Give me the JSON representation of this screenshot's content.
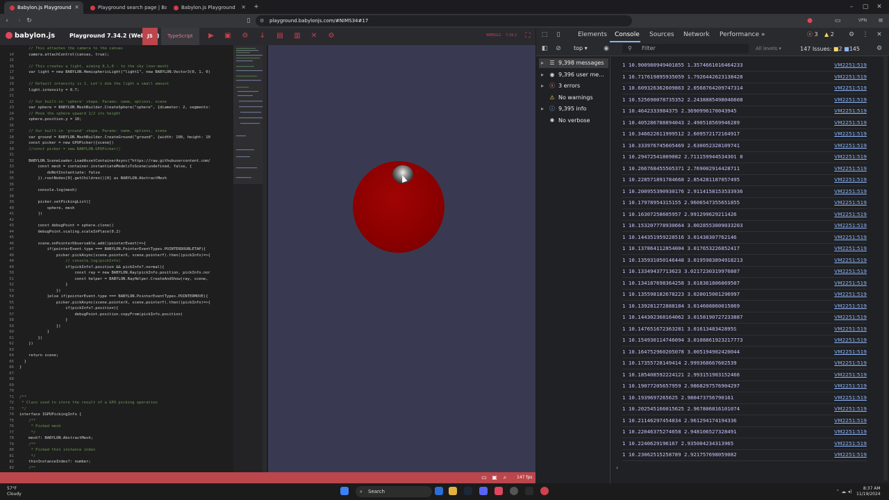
{
  "browser": {
    "tabs": [
      {
        "label": "Babylon.js Playground"
      },
      {
        "label": "Playground search page | Babylon.js"
      },
      {
        "label": "Babylon.js Playground"
      }
    ],
    "url": "playground.babylonjs.com/#NIMS34#17",
    "vpn": "VPN"
  },
  "playground": {
    "logo": "babylon.js",
    "title": "Playground 7.34.2 (WebGL2)",
    "js_label": "JS",
    "ts_label": "TypeScript",
    "version_a": "WEBGL2",
    "version_b": "7.34.2",
    "fps": "147 fps"
  },
  "editor": {
    "lines": [
      {
        "n": "",
        "t": "    // This attaches the camera to the canvas",
        "c": "cm"
      },
      {
        "n": "14",
        "t": "    camera.attachControl(canvas, true);",
        "c": ""
      },
      {
        "n": "15",
        "t": "",
        "c": ""
      },
      {
        "n": "16",
        "t": "    // This creates a light, aiming 0,1,0 - to the sky (non-mesh)",
        "c": "cm"
      },
      {
        "n": "17",
        "t": "    var light = new BABYLON.HemisphericLight(\"light1\", new BABYLON.Vector3(0, 1, 0)",
        "c": ""
      },
      {
        "n": "18",
        "t": "",
        "c": ""
      },
      {
        "n": "19",
        "t": "    // Default intensity is 1. Let's dim the light a small amount",
        "c": "cm"
      },
      {
        "n": "20",
        "t": "    light.intensity = 0.7;",
        "c": ""
      },
      {
        "n": "21",
        "t": "",
        "c": ""
      },
      {
        "n": "22",
        "t": "    // Our built-in 'sphere' shape. Params: name, options, scene",
        "c": "cm"
      },
      {
        "n": "23",
        "t": "    var sphere = BABYLON.MeshBuilder.CreateSphere(\"sphere\", {diameter: 2, segments:",
        "c": ""
      },
      {
        "n": "24",
        "t": "    // Move the sphere upward 1/2 its height",
        "c": "cm"
      },
      {
        "n": "25",
        "t": "    sphere.position.y = 10;",
        "c": ""
      },
      {
        "n": "26",
        "t": "",
        "c": ""
      },
      {
        "n": "27",
        "t": "    // Our built-in 'ground' shape. Params: name, options, scene",
        "c": "cm"
      },
      {
        "n": "28",
        "t": "    var ground = BABYLON.MeshBuilder.CreateGround(\"ground\", {width: 100, height: 10",
        "c": ""
      },
      {
        "n": "29",
        "t": "    const picker = new GPUPicker({scene})",
        "c": ""
      },
      {
        "n": "30",
        "t": "    //const picker = new BABYLON.GPUPicker()",
        "c": "cm"
      },
      {
        "n": "31",
        "t": "",
        "c": ""
      },
      {
        "n": "32",
        "t": "    BABYLON.SceneLoader.LoadAssetContainerAsync(\"https://raw.githubusercontent.com/",
        "c": ""
      },
      {
        "n": "33",
        "t": "        const mesh = container.instantiateModelsToScene(undefined, false, {",
        "c": ""
      },
      {
        "n": "34",
        "t": "            doNotInstantiate: false",
        "c": ""
      },
      {
        "n": "35",
        "t": "        }).rootNodes[0].getChildren()[0] as BABYLON.AbstractMesh",
        "c": ""
      },
      {
        "n": "36",
        "t": "",
        "c": ""
      },
      {
        "n": "37",
        "t": "        console.log(mesh)",
        "c": ""
      },
      {
        "n": "38",
        "t": "",
        "c": ""
      },
      {
        "n": "39",
        "t": "        picker.setPickingList([",
        "c": ""
      },
      {
        "n": "40",
        "t": "            sphere, mesh",
        "c": ""
      },
      {
        "n": "41",
        "t": "        ])",
        "c": ""
      },
      {
        "n": "42",
        "t": "",
        "c": ""
      },
      {
        "n": "43",
        "t": "        const debugPoint = sphere.clone()",
        "c": ""
      },
      {
        "n": "44",
        "t": "        debugPoint.scaling.scaleInPlace(0.2)",
        "c": ""
      },
      {
        "n": "45",
        "t": "",
        "c": ""
      },
      {
        "n": "46",
        "t": "        scene.onPointerObservable.add((pointerEvent)=>{",
        "c": ""
      },
      {
        "n": "47",
        "t": "            if(pointerEvent.type === BABYLON.PointerEventTypes.POINTERDOUBLETAP){",
        "c": ""
      },
      {
        "n": "48",
        "t": "                picker.pickAsync(scene.pointerX, scene.pointerY).then((pickInfo)=>{",
        "c": ""
      },
      {
        "n": "49",
        "t": "                    // console.log(pickInfo)",
        "c": "cm"
      },
      {
        "n": "49",
        "t": "                    if(pickInfo?.position && pickInfo?.normal){",
        "c": ""
      },
      {
        "n": "50",
        "t": "                        const ray = new BABYLON.Ray(pickInfo.position, pickInfo.nor",
        "c": ""
      },
      {
        "n": "51",
        "t": "                        const helper = BABYLON.RayHelper.CreateAndShow(ray, scene,",
        "c": ""
      },
      {
        "n": "52",
        "t": "                    }",
        "c": ""
      },
      {
        "n": "53",
        "t": "                })",
        "c": ""
      },
      {
        "n": "54",
        "t": "            }else if(pointerEvent.type === BABYLON.PointerEventTypes.POINTERMOVE){",
        "c": ""
      },
      {
        "n": "55",
        "t": "                picker.pickAsync(scene.pointerX, scene.pointerY).then((pickInfo)=>{",
        "c": ""
      },
      {
        "n": "56",
        "t": "                    if(pickInfo?.position){",
        "c": ""
      },
      {
        "n": "57",
        "t": "                        debugPoint.position.copyFrom(pickInfo.position)",
        "c": ""
      },
      {
        "n": "58",
        "t": "                    }",
        "c": ""
      },
      {
        "n": "59",
        "t": "                })",
        "c": ""
      },
      {
        "n": "60",
        "t": "            }",
        "c": ""
      },
      {
        "n": "61",
        "t": "        })",
        "c": ""
      },
      {
        "n": "62",
        "t": "    })",
        "c": ""
      },
      {
        "n": "63",
        "t": "",
        "c": ""
      },
      {
        "n": "64",
        "t": "    return scene;",
        "c": ""
      },
      {
        "n": "65",
        "t": "  }",
        "c": ""
      },
      {
        "n": "66",
        "t": "}",
        "c": ""
      },
      {
        "n": "67",
        "t": "",
        "c": ""
      },
      {
        "n": "68",
        "t": "",
        "c": ""
      },
      {
        "n": "69",
        "t": "",
        "c": ""
      },
      {
        "n": "70",
        "t": "",
        "c": ""
      },
      {
        "n": "71",
        "t": "/**",
        "c": "cm"
      },
      {
        "n": "72",
        "t": " * Class used to store the result of a GPU picking operation",
        "c": "cm"
      },
      {
        "n": "73",
        "t": " */",
        "c": "cm"
      },
      {
        "n": "74",
        "t": "interface IGPUPickingInfo {",
        "c": ""
      },
      {
        "n": "75",
        "t": "    /**",
        "c": "cm"
      },
      {
        "n": "76",
        "t": "     * Picked mesh",
        "c": "cm"
      },
      {
        "n": "77",
        "t": "     */",
        "c": "cm"
      },
      {
        "n": "78",
        "t": "    mesh?: BABYLON.AbstractMesh;",
        "c": ""
      },
      {
        "n": "79",
        "t": "    /**",
        "c": "cm"
      },
      {
        "n": "80",
        "t": "     * Picked thin instance index",
        "c": "cm"
      },
      {
        "n": "81",
        "t": "     */",
        "c": "cm"
      },
      {
        "n": "82",
        "t": "    thinInstanceIndex?: number;",
        "c": ""
      },
      {
        "n": "83",
        "t": "    /**",
        "c": "cm"
      }
    ]
  },
  "devtools": {
    "tabs": [
      "Elements",
      "Console",
      "Sources",
      "Network",
      "Performance"
    ],
    "more": "»",
    "errors_count": "3",
    "warnings_count": "2",
    "context": "top",
    "filter_placeholder": "Filter",
    "levels": "All levels",
    "issues_label": "147 Issues:",
    "issues_a": "2",
    "issues_b": "145",
    "sidebar": [
      {
        "label": "9,398 messages",
        "icon": "list-icon",
        "glyph": "☰"
      },
      {
        "label": "9,396 user me...",
        "icon": "user-icon",
        "glyph": "◉"
      },
      {
        "label": "3 errors",
        "icon": "error-icon",
        "glyph": "ⓧ"
      },
      {
        "label": "No warnings",
        "icon": "warning-icon",
        "glyph": "⚠"
      },
      {
        "label": "9,395 info",
        "icon": "info-icon",
        "glyph": "ⓘ"
      },
      {
        "label": "No verbose",
        "icon": "bug-icon",
        "glyph": "✱"
      }
    ],
    "log_source": "VM2251:519",
    "logs": [
      "1 10.900980949401855 1.3574661016464233",
      "1 10.717619895935059 1.7926442623138428",
      "1 10.609326362609863 2.0568764209747314",
      "1 10.525690078735352 2.2438885498046608",
      "1 10.4642333984375 2.3690996170043945",
      "1 10.405286788894043 2.490518569946289",
      "1 10.346622611999512 2.609572172164917",
      "1 10.333976745605469 2.630052328109741",
      "1 10.29472541809082 2.711159944534301 8",
      "1 10.266768455505371 2.769002914428711",
      "1 10.228571891784668 2.854281187057495",
      "1 10.200955390930176 2.9114158153533936",
      "1 10.17978954315155 2.9606547355651855",
      "1 10.16307258605957 2.991299629211426",
      "1 10.153207778930664 3.0028553009033203",
      "1 10.144351959228516 3.01438307762146",
      "1 10.137864112854004 3.017653226852417",
      "1 10.135931050146448 3.0195983894918213",
      "1 10.13349437713623 3.0217230319976807",
      "1 10.134187698364258 3.018361806869507",
      "1 10.135598182678223 3.020015001296997",
      "1 10.139281272888184 3.014608860015869",
      "1 10.144302368164062 3.0158190727233887",
      "1 10.147651672363281 3.0161348342895S",
      "1 10.154930114746094 3.0108861923217773",
      "1 10.164752960205078 3.005194902420044",
      "1 10.17355728149414 2.999368667602539",
      "1 10.185408592224121 2.993151903152466",
      "1 10.19077205657959 2.9868297576904297",
      "1 10.1939697265625 2.980473756790161",
      "1 10.202545166015625 2.967806816101074",
      "1 10.21146297454834 2.961294174194336",
      "1 10.22046375274658 2.948106527328491",
      "1 10.2240629196167 2.935004234313965",
      "1 10.23062515258789 2.921757698059082"
    ],
    "prompt": "›"
  },
  "taskbar": {
    "temp": "57°F",
    "weather": "Cloudy",
    "search": "Search",
    "time": "8:37 AM",
    "date": "11/19/2024"
  }
}
